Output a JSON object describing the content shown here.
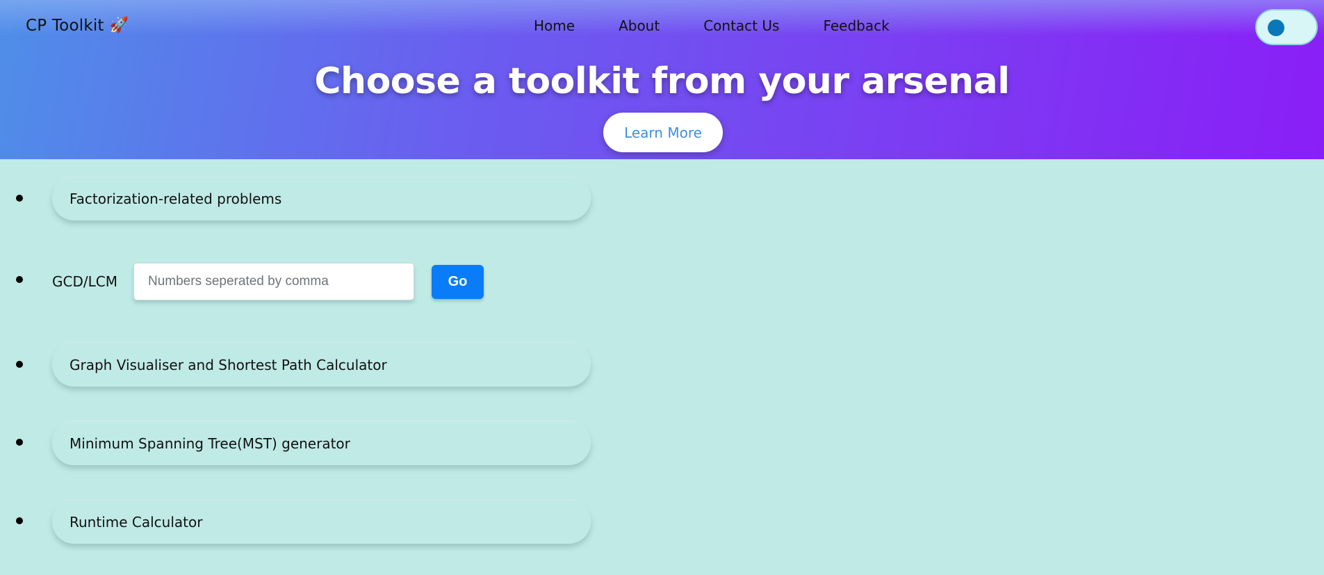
{
  "brand": {
    "name": "CP Toolkit",
    "icon": "rocket-icon"
  },
  "nav": {
    "items": [
      {
        "label": "Home"
      },
      {
        "label": "About"
      },
      {
        "label": "Contact Us"
      },
      {
        "label": "Feedback"
      }
    ]
  },
  "theme_toggle": {
    "state": "off"
  },
  "hero": {
    "title": "Choose a toolkit from your arsenal",
    "button_label": "Learn More"
  },
  "tools": {
    "factorization": "Factorization-related problems",
    "gcd_lcm": {
      "label": "GCD/LCM",
      "input_value": "",
      "input_placeholder": "Numbers seperated by comma",
      "go_label": "Go"
    },
    "graph": "Graph Visualiser and Shortest Path Calculator",
    "mst": "Minimum Spanning Tree(MST) generator",
    "runtime": "Runtime Calculator"
  },
  "colors": {
    "page_background": "#c0eae6",
    "header_gradient_start": "#4f8ee8",
    "header_gradient_end": "#8a1ef7",
    "go_button": "#0a7cf7",
    "learn_more_text": "#3d8fe0",
    "toggle_knob": "#0a78b8"
  }
}
